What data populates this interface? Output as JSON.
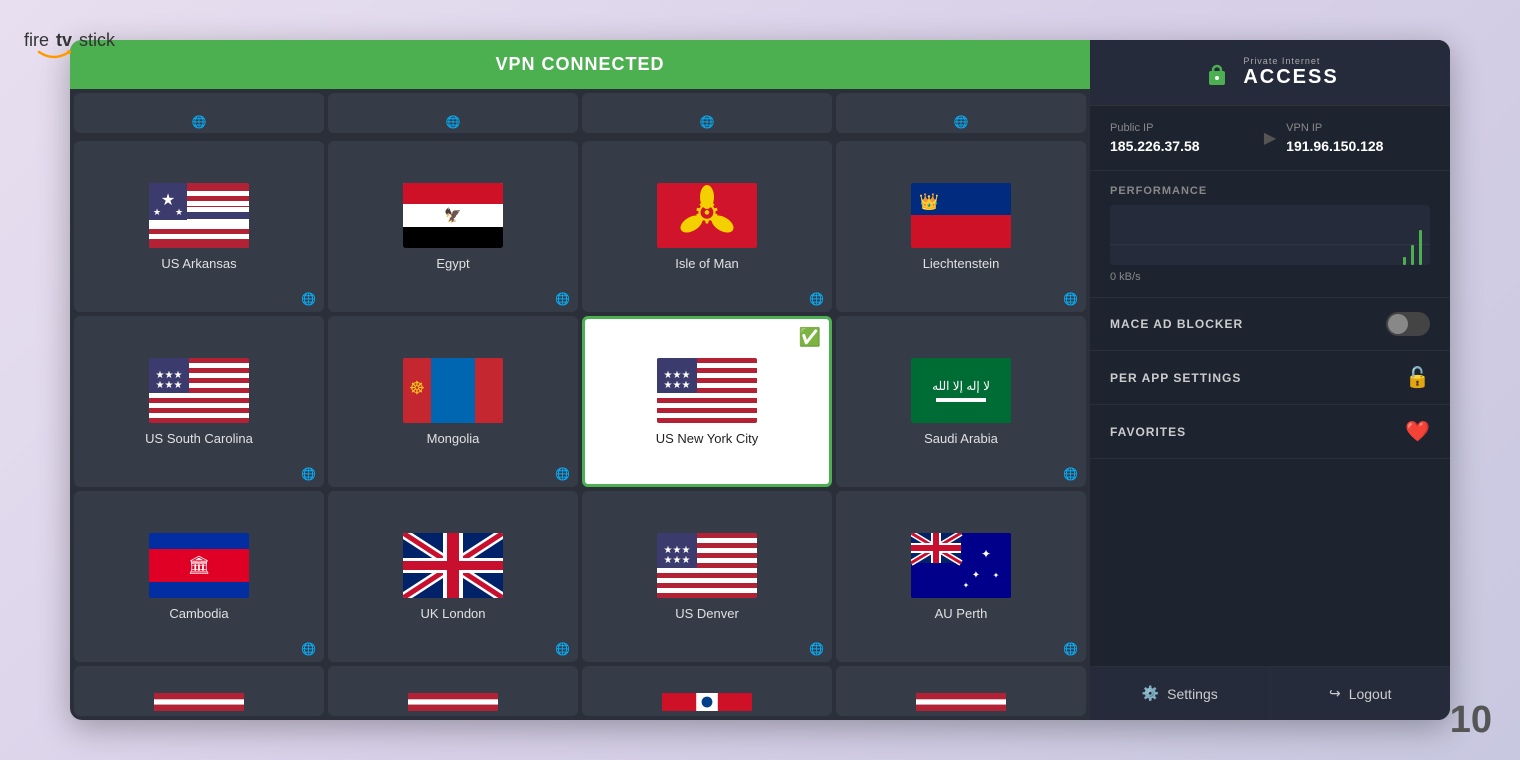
{
  "app": {
    "logo_fire": "fire",
    "logo_tv": "tv",
    "logo_stick": "stick",
    "corner_number": "10"
  },
  "vpn_banner": {
    "text": "VPN CONNECTED",
    "color": "#4caf50"
  },
  "pia": {
    "name": "ACCESS",
    "subtitle": "Private Internet",
    "lock_symbol": "🔒"
  },
  "ip_info": {
    "public_label": "Public IP",
    "public_value": "185.226.37.58",
    "vpn_label": "VPN IP",
    "vpn_value": "191.96.150.128"
  },
  "performance": {
    "label": "PERFORMANCE",
    "speed": "0 kB/s"
  },
  "mace": {
    "label": "MACE AD BLOCKER"
  },
  "per_app": {
    "label": "PER APP SETTINGS"
  },
  "favorites": {
    "label": "FAVORITES"
  },
  "actions": {
    "settings": "Settings",
    "logout": "Logout"
  },
  "locations": [
    {
      "id": "us-arkansas",
      "name": "US Arkansas",
      "flag": "us",
      "selected": false
    },
    {
      "id": "egypt",
      "name": "Egypt",
      "flag": "egypt",
      "selected": false
    },
    {
      "id": "isle-of-man",
      "name": "Isle of Man",
      "flag": "isle-of-man",
      "selected": false
    },
    {
      "id": "liechtenstein",
      "name": "Liechtenstein",
      "flag": "liechtenstein",
      "selected": false
    },
    {
      "id": "us-south-carolina",
      "name": "US South Carolina",
      "flag": "us",
      "selected": false
    },
    {
      "id": "mongolia",
      "name": "Mongolia",
      "flag": "mongolia",
      "selected": false
    },
    {
      "id": "us-new-york-city",
      "name": "US New York City",
      "flag": "us",
      "selected": true
    },
    {
      "id": "saudi-arabia",
      "name": "Saudi Arabia",
      "flag": "saudi",
      "selected": false
    },
    {
      "id": "cambodia",
      "name": "Cambodia",
      "flag": "cambodia",
      "selected": false
    },
    {
      "id": "uk-london",
      "name": "UK London",
      "flag": "uk",
      "selected": false
    },
    {
      "id": "us-denver",
      "name": "US Denver",
      "flag": "us",
      "selected": false
    },
    {
      "id": "au-perth",
      "name": "AU Perth",
      "flag": "australia",
      "selected": false
    }
  ]
}
